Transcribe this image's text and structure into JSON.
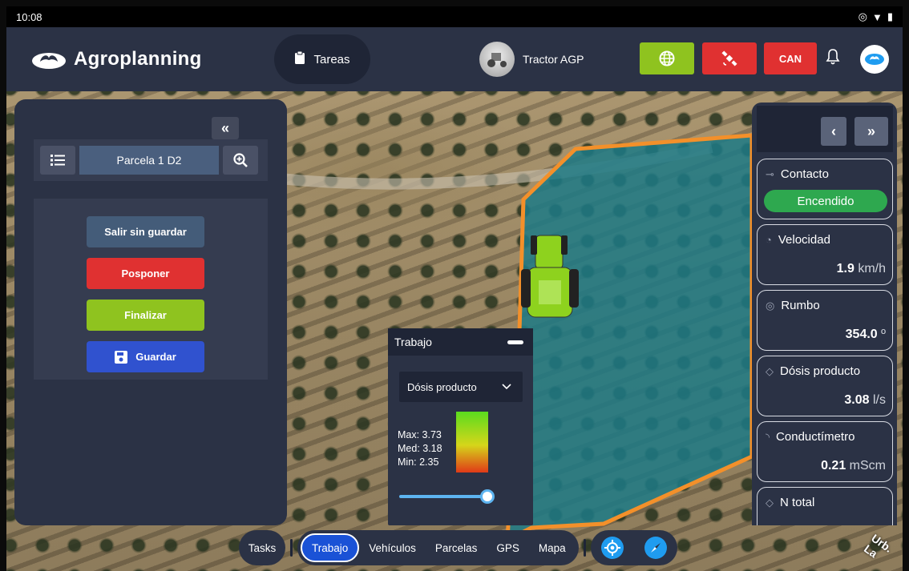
{
  "statusbar": {
    "time": "10:08"
  },
  "app": {
    "brand": "Agroplanning"
  },
  "header": {
    "tasks_tab": "Tareas",
    "vehicle_name": "Tractor AGP",
    "can_label": "CAN",
    "colors": {
      "green": "#8fc31f",
      "red": "#e03131",
      "panel": "#2b3245"
    }
  },
  "left_panel": {
    "parcel_name": "Parcela 1 D2",
    "buttons": {
      "exit_without_saving": "Salir sin guardar",
      "postpone": "Posponer",
      "finish": "Finalizar",
      "save": "Guardar"
    }
  },
  "work_panel": {
    "title": "Trabajo",
    "selected_layer": "Dósis producto",
    "legend": {
      "max": "Max: 3.73",
      "med": "Med: 3.18",
      "min": "Min: 2.35"
    },
    "slider_level": 1.0
  },
  "right_panel": {
    "cards": [
      {
        "title": "Contacto",
        "status": "Encendido",
        "icon": "key-icon"
      },
      {
        "title": "Velocidad",
        "value": "1.9",
        "unit": "km/h",
        "icon": "speedometer-icon"
      },
      {
        "title": "Rumbo",
        "value": "354.0",
        "unit": "º",
        "icon": "compass-icon"
      },
      {
        "title": "Dósis producto",
        "value": "3.08",
        "unit": "l/s",
        "icon": "drop-icon"
      },
      {
        "title": "Conductímetro",
        "value": "0.21",
        "unit": "mScm",
        "icon": "signal-icon"
      },
      {
        "title": "N total",
        "icon": "drop-icon"
      }
    ]
  },
  "bottom_nav": {
    "tasks": "Tasks",
    "tabs": [
      "Trabajo",
      "Vehículos",
      "Parcelas",
      "GPS",
      "Mapa"
    ],
    "active_tab": "Trabajo"
  },
  "map": {
    "watermark": "Urb. La"
  }
}
